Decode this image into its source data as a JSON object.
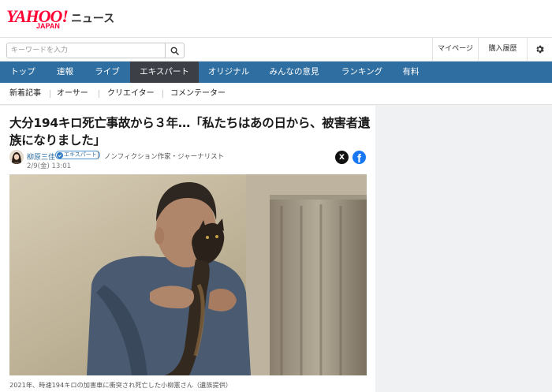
{
  "header": {
    "logo_main": "YAHOO!",
    "logo_sub": "JAPAN",
    "logo_service": "ニュース"
  },
  "search": {
    "placeholder": "キーワードを入力"
  },
  "header_links": {
    "mypage": "マイページ",
    "history": "購入履歴"
  },
  "nav": {
    "items": [
      "トップ",
      "速報",
      "ライブ",
      "エキスパート",
      "オリジナル",
      "みんなの意見",
      "ランキング",
      "有料"
    ],
    "active": "エキスパート"
  },
  "subnav": {
    "items": [
      "新着記事",
      "オーサー",
      "クリエイター",
      "コメンテーター"
    ]
  },
  "article": {
    "headline": "大分194キロ死亡事故から３年…「私たちはあの日から、被害者遺族になりました」",
    "author": "柳原三佳",
    "badge": "エキスパート",
    "author_title": "ノンフィクション作家・ジャーナリスト",
    "date": "2/9(金) 13:01",
    "caption": "2021年、時速194キロの加害車に衝突され死亡した小柳憲さん（遺族提供）"
  },
  "share": {
    "x_label": "X",
    "facebook_label": "f"
  },
  "colors": {
    "nav_bg": "#2f6ea0",
    "nav_active": "#3c3f46",
    "brand_red": "#ff0033",
    "facebook": "#1877f2"
  }
}
